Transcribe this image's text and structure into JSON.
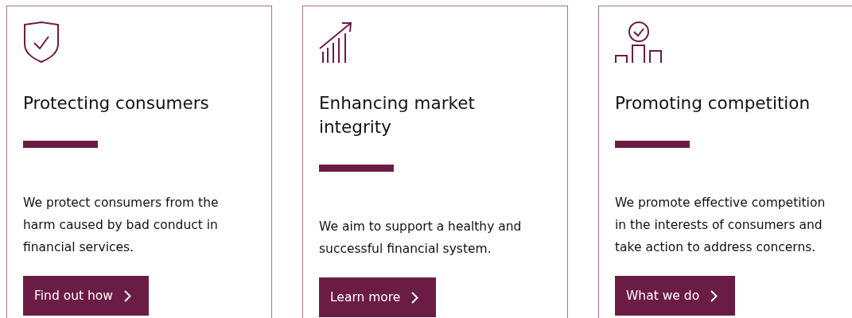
{
  "cards": [
    {
      "title": "Protecting consumers",
      "body": "We protect consumers from the\nharm caused by bad conduct in\nfinancial services.",
      "button": "Find out how"
    },
    {
      "title": "Enhancing market\nintegrity",
      "body": "We aim to support a healthy and\nsuccessful financial system.",
      "button": "Learn more"
    },
    {
      "title": "Promoting competition",
      "body": "We promote effective competition\nin the interests of consumers and\ntake action to address concerns.",
      "button": "What we do"
    }
  ]
}
